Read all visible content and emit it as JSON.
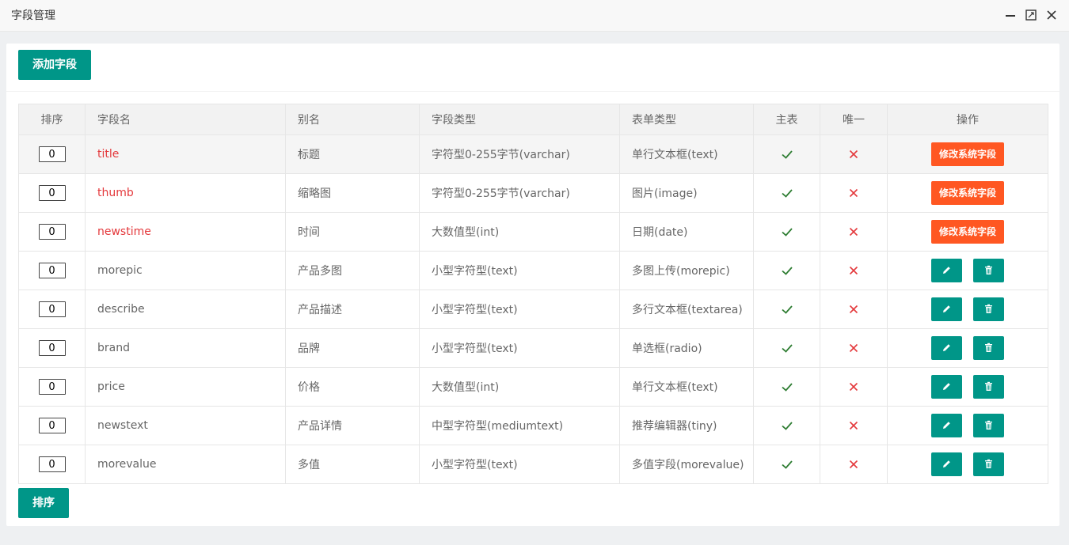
{
  "window": {
    "title": "字段管理"
  },
  "toolbar": {
    "add_label": "添加字段"
  },
  "table": {
    "headers": [
      "排序",
      "字段名",
      "别名",
      "字段类型",
      "表单类型",
      "主表",
      "唯一",
      "操作"
    ],
    "sys_edit_label": "修改系统字段",
    "rows": [
      {
        "order": "0",
        "field": "title",
        "alias": "标题",
        "type": "字符型0-255字节(varchar)",
        "form": "单行文本框(text)",
        "main": true,
        "unique": false,
        "system": true
      },
      {
        "order": "0",
        "field": "thumb",
        "alias": "缩略图",
        "type": "字符型0-255字节(varchar)",
        "form": "图片(image)",
        "main": true,
        "unique": false,
        "system": true
      },
      {
        "order": "0",
        "field": "newstime",
        "alias": "时间",
        "type": "大数值型(int)",
        "form": "日期(date)",
        "main": true,
        "unique": false,
        "system": true
      },
      {
        "order": "0",
        "field": "morepic",
        "alias": "产品多图",
        "type": "小型字符型(text)",
        "form": "多图上传(morepic)",
        "main": true,
        "unique": false,
        "system": false
      },
      {
        "order": "0",
        "field": "describe",
        "alias": "产品描述",
        "type": "小型字符型(text)",
        "form": "多行文本框(textarea)",
        "main": true,
        "unique": false,
        "system": false
      },
      {
        "order": "0",
        "field": "brand",
        "alias": "品牌",
        "type": "小型字符型(text)",
        "form": "单选框(radio)",
        "main": true,
        "unique": false,
        "system": false
      },
      {
        "order": "0",
        "field": "price",
        "alias": "价格",
        "type": "大数值型(int)",
        "form": "单行文本框(text)",
        "main": true,
        "unique": false,
        "system": false
      },
      {
        "order": "0",
        "field": "newstext",
        "alias": "产品详情",
        "type": "中型字符型(mediumtext)",
        "form": "推荐编辑器(tiny)",
        "main": true,
        "unique": false,
        "system": false
      },
      {
        "order": "0",
        "field": "morevalue",
        "alias": "多值",
        "type": "小型字符型(text)",
        "form": "多值字段(morevalue)",
        "main": true,
        "unique": false,
        "system": false
      }
    ]
  },
  "footer": {
    "sort_label": "排序"
  },
  "colors": {
    "primary": "#009688",
    "danger": "#ff5722",
    "check": "#2e7d32",
    "cross": "#e4393c",
    "system_field": "#e4393c"
  }
}
